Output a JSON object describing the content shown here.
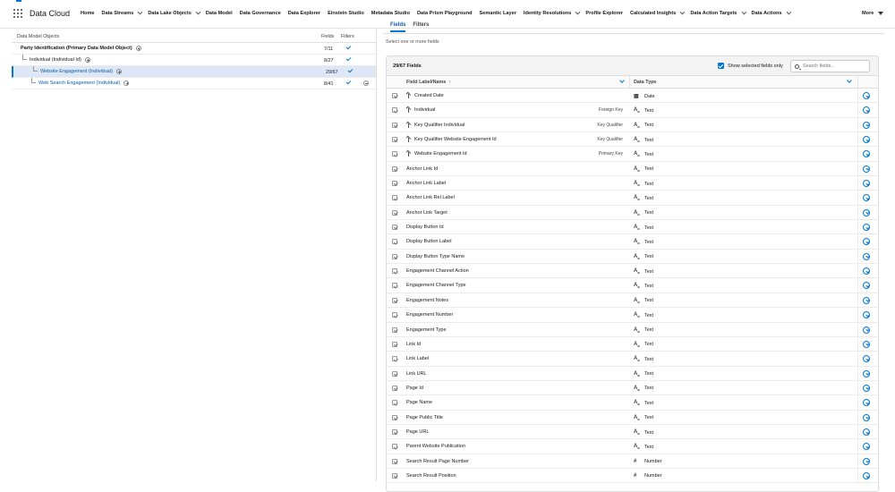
{
  "app": {
    "title": "Data Cloud",
    "nav": [
      {
        "label": "Home",
        "dropdown": false
      },
      {
        "label": "Data Streams",
        "dropdown": true
      },
      {
        "label": "Data Lake Objects",
        "dropdown": true
      },
      {
        "label": "Data Model",
        "dropdown": false
      },
      {
        "label": "Data Governance",
        "dropdown": false
      },
      {
        "label": "Data Explorer",
        "dropdown": false
      },
      {
        "label": "Einstein Studio",
        "dropdown": false
      },
      {
        "label": "Metadata Studio",
        "dropdown": false
      },
      {
        "label": "Data Prism Playground",
        "dropdown": false
      },
      {
        "label": "Semantic Layer",
        "dropdown": false
      },
      {
        "label": "Identity Resolutions",
        "dropdown": true
      },
      {
        "label": "Profile Explorer",
        "dropdown": false
      },
      {
        "label": "Calculated Insights",
        "dropdown": true
      },
      {
        "label": "Data Action Targets",
        "dropdown": true
      },
      {
        "label": "Data Actions",
        "dropdown": true
      }
    ],
    "more_label": "More"
  },
  "left": {
    "header": {
      "objects": "Data Model Objects",
      "fields": "Fields",
      "filters": "Filters"
    },
    "rows": [
      {
        "label": "Party Identification (Primary Data Model Object)",
        "fields": "7/11",
        "style": "bold",
        "indent": 0,
        "selected": false,
        "minus": false
      },
      {
        "label": "Individual (Individual Id)",
        "fields": "8/27",
        "style": "plain",
        "indent": 1,
        "selected": false,
        "minus": false
      },
      {
        "label": "Website Engagement (Individual)",
        "fields": "29/67",
        "style": "link",
        "indent": 2,
        "selected": true,
        "minus": false
      },
      {
        "label": "Web Search Engagement (Individual)",
        "fields": "8/41",
        "style": "link",
        "indent": 2,
        "selected": false,
        "minus": true
      }
    ]
  },
  "right": {
    "tabs": [
      {
        "label": "Fields",
        "active": true
      },
      {
        "label": "Filters",
        "active": false
      }
    ],
    "hint": "Select one or more fields",
    "count": "29/67 Fields",
    "show_selected_label": "Show selected fields only",
    "search_placeholder": "Search fields...",
    "col_field": "Field Label/Name",
    "col_type": "Data Type",
    "fields": [
      {
        "name": "Created Date",
        "key": "",
        "icon": false,
        "type": "Date",
        "type_icon": "calendar-icon"
      },
      {
        "name": "Individual",
        "key": "Foreign Key",
        "icon": true,
        "type": "Text",
        "type_icon": "text-icon"
      },
      {
        "name": "Key Qualifier Individual",
        "key": "Key Qualifier",
        "icon": true,
        "type": "Text",
        "type_icon": "text-icon"
      },
      {
        "name": "Key Qualifier Website Engagement Id",
        "key": "Key Qualifier",
        "icon": true,
        "type": "Text",
        "type_icon": "text-icon"
      },
      {
        "name": "Website Engagement Id",
        "key": "Primary Key",
        "icon": true,
        "type": "Text",
        "type_icon": "text-icon"
      },
      {
        "name": "Anchor Link Id",
        "key": "",
        "icon": false,
        "type": "Text",
        "type_icon": "text-icon"
      },
      {
        "name": "Anchor Link Label",
        "key": "",
        "icon": false,
        "type": "Text",
        "type_icon": "text-icon"
      },
      {
        "name": "Anchor Link Rel Label",
        "key": "",
        "icon": false,
        "type": "Text",
        "type_icon": "text-icon"
      },
      {
        "name": "Anchor Link Target",
        "key": "",
        "icon": false,
        "type": "Text",
        "type_icon": "text-icon"
      },
      {
        "name": "Display Button Id",
        "key": "",
        "icon": false,
        "type": "Text",
        "type_icon": "text-icon"
      },
      {
        "name": "Display Button Label",
        "key": "",
        "icon": false,
        "type": "Text",
        "type_icon": "text-icon"
      },
      {
        "name": "Display Button Type Name",
        "key": "",
        "icon": false,
        "type": "Text",
        "type_icon": "text-icon"
      },
      {
        "name": "Engagement Channel Action",
        "key": "",
        "icon": false,
        "type": "Text",
        "type_icon": "text-icon"
      },
      {
        "name": "Engagement Channel Type",
        "key": "",
        "icon": false,
        "type": "Text",
        "type_icon": "text-icon"
      },
      {
        "name": "Engagement Notes",
        "key": "",
        "icon": false,
        "type": "Text",
        "type_icon": "text-icon"
      },
      {
        "name": "Engagement Number",
        "key": "",
        "icon": false,
        "type": "Text",
        "type_icon": "text-icon"
      },
      {
        "name": "Engagement Type",
        "key": "",
        "icon": false,
        "type": "Text",
        "type_icon": "text-icon"
      },
      {
        "name": "Link Id",
        "key": "",
        "icon": false,
        "type": "Text",
        "type_icon": "text-icon"
      },
      {
        "name": "Link Label",
        "key": "",
        "icon": false,
        "type": "Text",
        "type_icon": "text-icon"
      },
      {
        "name": "Link URL",
        "key": "",
        "icon": false,
        "type": "Text",
        "type_icon": "text-icon"
      },
      {
        "name": "Page Id",
        "key": "",
        "icon": false,
        "type": "Text",
        "type_icon": "text-icon"
      },
      {
        "name": "Page Name",
        "key": "",
        "icon": false,
        "type": "Text",
        "type_icon": "text-icon"
      },
      {
        "name": "Page Public Title",
        "key": "",
        "icon": false,
        "type": "Text",
        "type_icon": "text-icon"
      },
      {
        "name": "Page URL",
        "key": "",
        "icon": false,
        "type": "Text",
        "type_icon": "text-icon"
      },
      {
        "name": "Parent Website Publication",
        "key": "",
        "icon": false,
        "type": "Text",
        "type_icon": "text-icon"
      },
      {
        "name": "Search Result Page Number",
        "key": "",
        "icon": false,
        "type": "Number",
        "type_icon": "number-icon"
      },
      {
        "name": "Search Result Position",
        "key": "",
        "icon": false,
        "type": "Number",
        "type_icon": "number-icon"
      }
    ]
  },
  "colors": {
    "accent": "#0176d3",
    "link": "#0b5cab",
    "selected_row": "#dde7f5"
  }
}
